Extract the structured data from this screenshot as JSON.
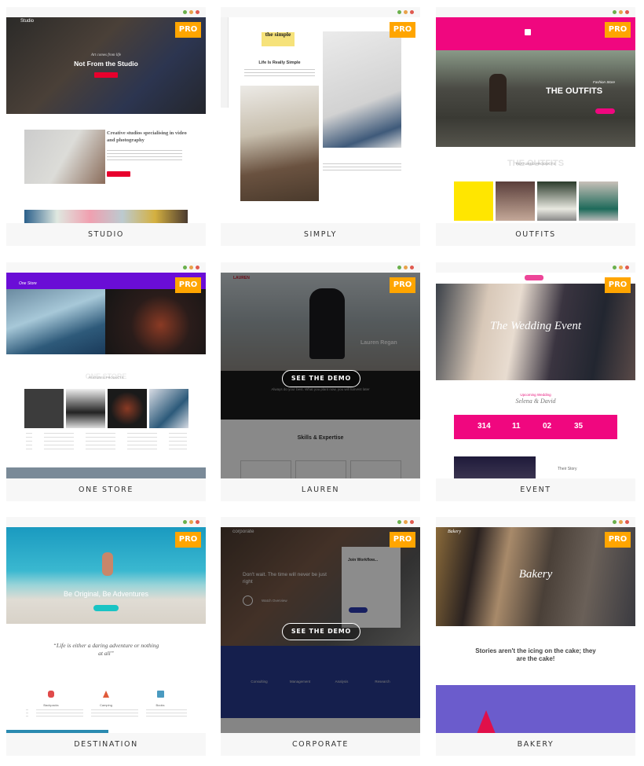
{
  "badge": "PRO",
  "demo_label": "SEE THE DEMO",
  "colors": {
    "badge": "#ffa500",
    "dot_green": "#6ab04c",
    "dot_orange": "#e8a24a",
    "dot_red": "#e05a4f",
    "outfits_pink": "#f0077f",
    "onestore_purple": "#6a0dd6",
    "corporate_blue": "#273a8c",
    "bakery_purple": "#6b5ccc"
  },
  "cards": [
    {
      "label": "STUDIO",
      "logo": "Studio",
      "subtitle": "Art comes from life",
      "title": "Not From the Studio",
      "heading": "Creative studios specialising in video and photography"
    },
    {
      "label": "SIMPLY",
      "logo": "the simple",
      "title": "Life Is Really Simple"
    },
    {
      "label": "OUTFITS",
      "kicker": "Fashion Store",
      "title": "THE OUTFITS",
      "section": "THE OUTFITS",
      "section_sub": "FEATURED PRODUCTS"
    },
    {
      "label": "ONE STORE",
      "logo": "One Store",
      "section": "ONE STORE",
      "section_sub": "FEATURED PRODUCTS"
    },
    {
      "label": "LAUREN",
      "logo": "LAUREN",
      "name": "Lauren Regan",
      "quote": "Always do your best. What you plant now, you will harvest later",
      "section": "Skills & Expertise"
    },
    {
      "label": "EVENT",
      "title": "The Wedding Event",
      "kicker": "Upcoming Wedding",
      "couple": "Selena & David",
      "countdown": [
        "314",
        "11",
        "02",
        "35"
      ],
      "story": "Their Story"
    },
    {
      "label": "DESTINATION",
      "title": "Be Original, Be Adventures",
      "quote": "“Life is either a daring adventure or nothing at all”",
      "features": [
        "Backpacks",
        "Camping",
        "Books"
      ]
    },
    {
      "label": "CORPORATE",
      "logo": "corporate",
      "title": "Don't wait. The time will never be just right",
      "form_title": "Join Workflow...",
      "overview": "Watch Overview",
      "services": [
        "Consulting",
        "Management",
        "Analysis",
        "Research"
      ]
    },
    {
      "label": "BAKERY",
      "logo": "Bakery",
      "title": "Bakery",
      "quote": "Stories aren't the icing on the cake; they are the cake!"
    }
  ]
}
